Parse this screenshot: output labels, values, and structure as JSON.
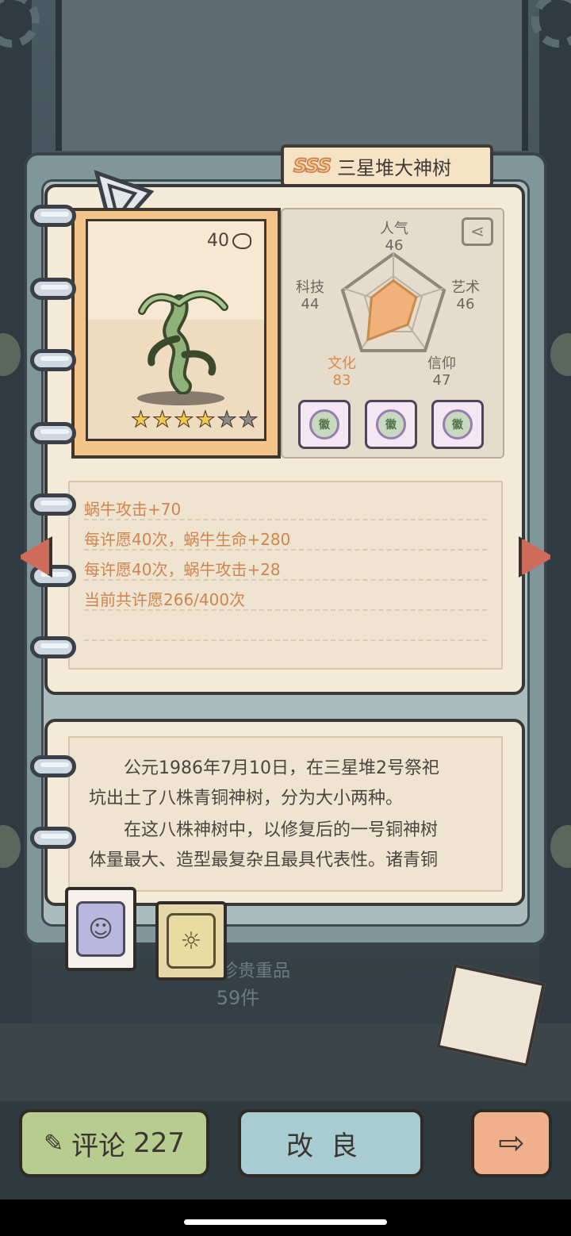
{
  "item": {
    "grade": "SSS",
    "name": "三星堆大神树",
    "level": "40",
    "stars_filled": 4,
    "stars_total": 6
  },
  "stats": {
    "popularity": {
      "label": "人气",
      "value": "46"
    },
    "art": {
      "label": "艺术",
      "value": "46"
    },
    "faith": {
      "label": "信仰",
      "value": "47"
    },
    "culture": {
      "label": "文化",
      "value": "83"
    },
    "tech": {
      "label": "科技",
      "value": "44"
    }
  },
  "badges": [
    "徽",
    "徽",
    "徽"
  ],
  "effects": [
    "蜗牛攻击+70",
    "每许愿40次，蜗牛生命+280",
    "每许愿40次，蜗牛攻击+28",
    "当前共许愿266/400次"
  ],
  "description": [
    "　　公元1986年7月10日，在三星堆2号祭祀",
    "坑出土了八株青铜神树，分为大小两种。",
    "　　在这八株神树中，以修复后的一号铜神树",
    "体量最大、造型最复杂且最具代表性。诸青铜"
  ],
  "counter": {
    "line1": "共有珍贵重品",
    "line2": "59件"
  },
  "buttons": {
    "comment_label": "评论",
    "comment_count": "227",
    "improve_label": "改良",
    "next_label": "⇨"
  },
  "colors": {
    "highlight_stat": "#d98a4a",
    "effect_text": "#cf8451",
    "radar_fill": "#f0b27a"
  }
}
